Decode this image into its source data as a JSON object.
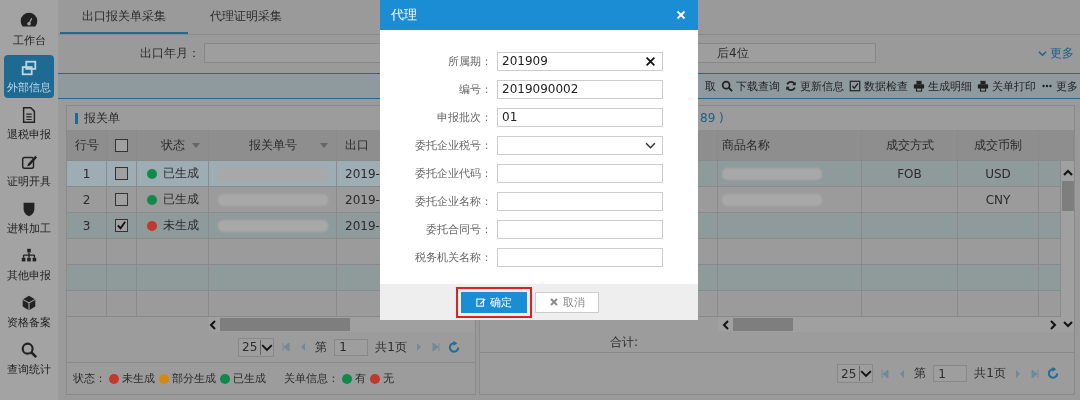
{
  "sidebar": {
    "items": [
      {
        "label": "工作台",
        "selected": false
      },
      {
        "label": "外部信息",
        "selected": true
      },
      {
        "label": "退税申报",
        "selected": false
      },
      {
        "label": "证明开具",
        "selected": false
      },
      {
        "label": "进料加工",
        "selected": false
      },
      {
        "label": "其他申报",
        "selected": false
      },
      {
        "label": "资格备案",
        "selected": false
      },
      {
        "label": "查询统计",
        "selected": false
      }
    ]
  },
  "tabs": [
    {
      "label": "出口报关单采集",
      "selected": true
    },
    {
      "label": "代理证明采集",
      "selected": false
    }
  ],
  "filters": {
    "label": "出口年月：",
    "placeholder": "后4位",
    "more": "更多"
  },
  "toolbar": [
    {
      "label": "取"
    },
    {
      "label": "下载查询"
    },
    {
      "label": "更新信息"
    },
    {
      "label": "数据检查"
    },
    {
      "label": "生成明细"
    },
    {
      "label": "关单打印"
    },
    {
      "label": "更多"
    }
  ],
  "left_panel": {
    "title": "报关单",
    "columns": [
      "行号",
      "状态",
      "报关单号",
      "出口"
    ],
    "all_checked": false,
    "rows": [
      {
        "row_no": "1",
        "checked": false,
        "selected": true,
        "status": "已生成",
        "color": "#0f8a4a",
        "date": "2019-"
      },
      {
        "row_no": "2",
        "checked": false,
        "selected": false,
        "status": "已生成",
        "color": "#0f8a4a",
        "date": "2019-"
      },
      {
        "row_no": "3",
        "checked": true,
        "selected": false,
        "status": "未生成",
        "color": "#c0392b",
        "date": "2019-"
      }
    ],
    "pagination": {
      "page_size": "25",
      "page_label": "第",
      "page": "1",
      "total": "共1页"
    }
  },
  "legend": {
    "status_label": "状态：",
    "status_items": [
      {
        "label": "未生成",
        "color": "#c0392b"
      },
      {
        "label": "部分生成",
        "color": "#d68910"
      },
      {
        "label": "已生成",
        "color": "#0f8a4a"
      }
    ],
    "gate_label": "关单信息：",
    "gate_items": [
      {
        "label": "有",
        "color": "#0f8a4a"
      },
      {
        "label": "无",
        "color": "#c0392b"
      }
    ]
  },
  "right_panel": {
    "title": "89 )",
    "columns": [
      "商品名称",
      "成交方式",
      "成交币制"
    ],
    "rows": [
      {
        "terms": "FOB",
        "currency": "USD"
      },
      {
        "currency": "CNY"
      }
    ],
    "total_label": "合计:",
    "pagination": {
      "page_size": "25",
      "page_label": "第",
      "page": "1",
      "total": "共1页"
    }
  },
  "modal": {
    "title": "代理",
    "fields": [
      {
        "label": "所属期：",
        "value": "201909",
        "kind": "clearable"
      },
      {
        "label": "编号：",
        "value": "2019090002",
        "kind": "text"
      },
      {
        "label": "申报批次：",
        "value": "01",
        "kind": "text"
      },
      {
        "label": "委托企业税号：",
        "kind": "select"
      },
      {
        "label": "委托企业代码：",
        "kind": "text"
      },
      {
        "label": "委托企业名称：",
        "kind": "text"
      },
      {
        "label": "委托合同号：",
        "kind": "text"
      },
      {
        "label": "税务机关名称：",
        "kind": "text"
      }
    ],
    "confirm": "确定",
    "cancel": "取消",
    "confirm_highlighted": true
  }
}
